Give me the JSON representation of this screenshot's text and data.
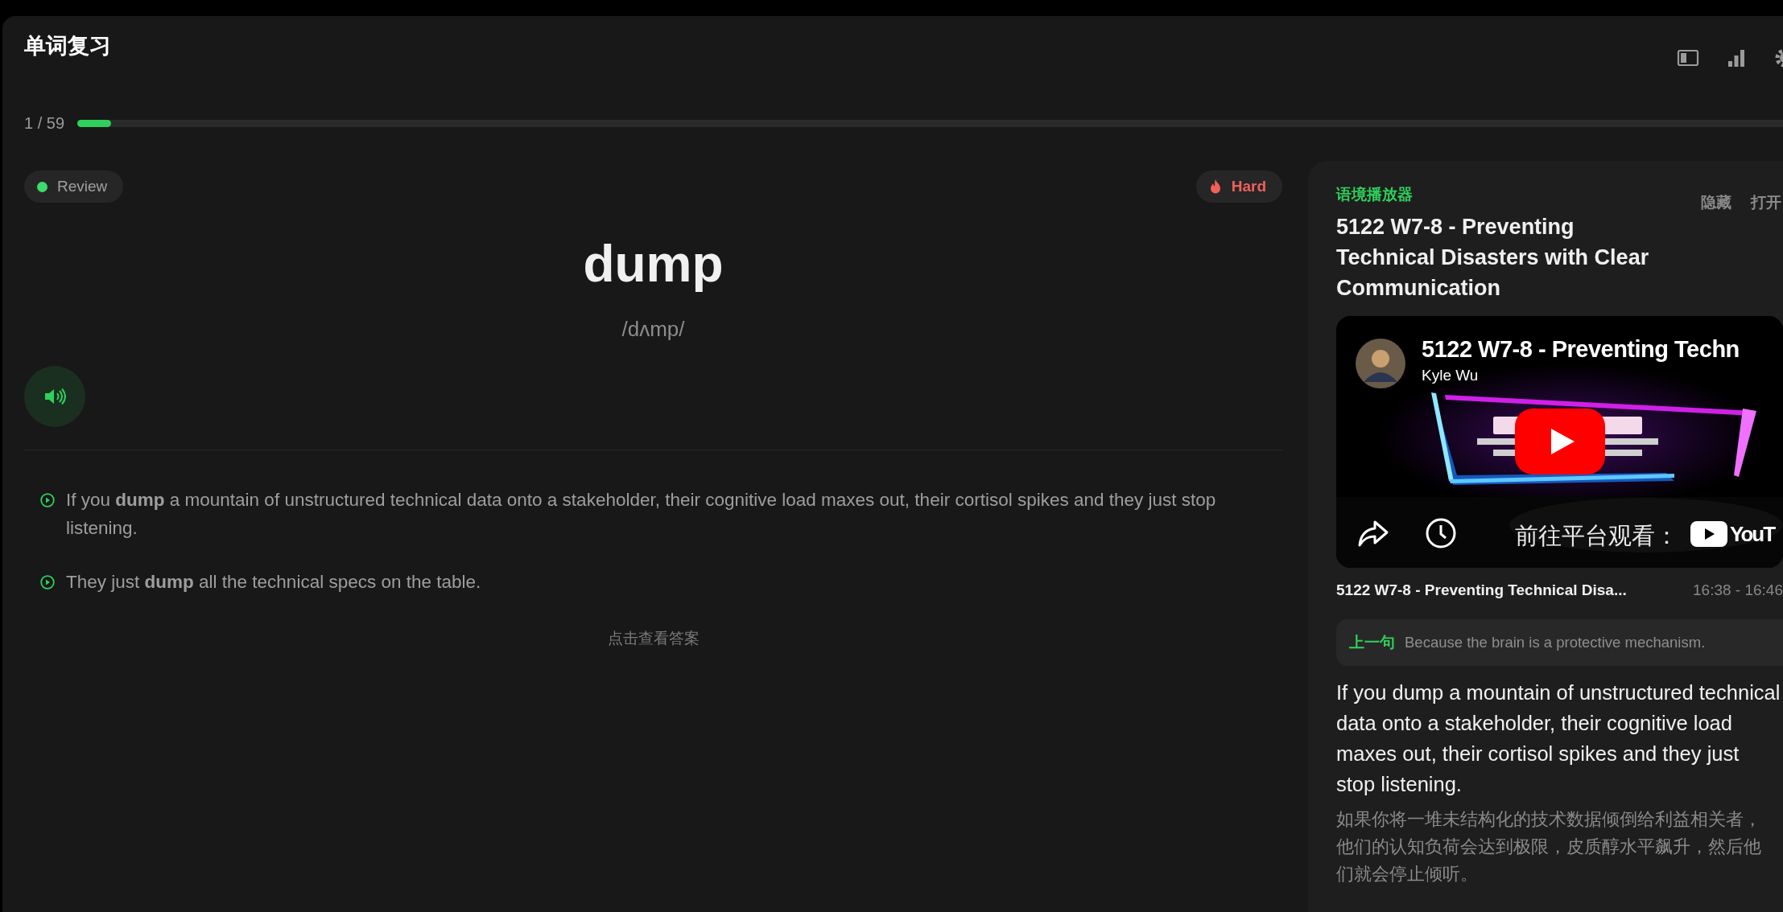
{
  "app": {
    "title": "单词复习"
  },
  "progress": {
    "text": "1 / 59",
    "level": 0.017
  },
  "card": {
    "status": "Review",
    "difficulty": "Hard",
    "word": "dump",
    "phonetic": "/dʌmp/",
    "examples": [
      "If you **dump** a mountain of unstructured technical data onto a stakeholder, their cognitive load maxes out, their cortisol spikes and they just stop listening.",
      "They just **dump** all the technical specs on the table."
    ],
    "reveal_hint": "点击查看答案"
  },
  "context_player": {
    "label": "语境播放器",
    "actions": [
      "隐藏",
      "打开"
    ],
    "title": "5122 W7-8 - Preventing Technical Disasters with Clear Communication",
    "video": {
      "title": "5122 W7-8 - Preventing Techn",
      "channel": "Kyle Wu",
      "watch_on": "前往平台观看：",
      "platform": "YouT"
    },
    "clip_title": "5122 W7-8 - Preventing Technical Disa...",
    "clip_time": "16:38 - 16:46",
    "previous": {
      "label": "上一句",
      "text": "Because the brain is a protective mechanism."
    },
    "sentence": "If you dump a mountain of unstructured technical data onto a stakeholder, their cognitive load maxes out, their cortisol spikes and they just stop listening.",
    "translation": "如果你将一堆未结构化的技术数据倾倒给利益相关者，他们的认知负荷会达到极限，皮质醇水平飙升，然后他们就会停止倾听。"
  }
}
